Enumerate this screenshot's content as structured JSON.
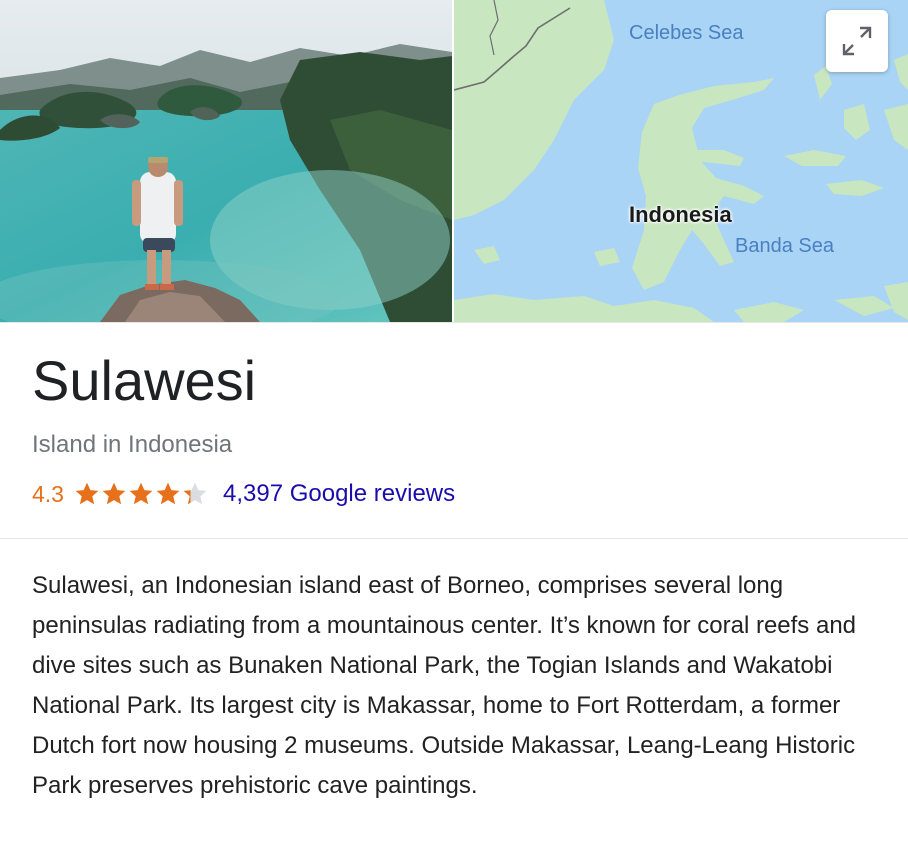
{
  "place": {
    "title": "Sulawesi",
    "subtitle": "Island in Indonesia",
    "rating": "4.3",
    "stars_filled": 4.3,
    "stars_total": 5,
    "reviews_link": "4,397 Google reviews",
    "description": "Sulawesi, an Indonesian island east of Borneo, comprises several long peninsulas radiating from a mountainous center. It’s known for coral reefs and dive sites such as Bunaken National Park, the Togian Islands and Wakatobi National Park. Its largest city is Makassar, home to Fort Rotterdam, a former Dutch fort now housing 2 museums. Outside Makassar, Leang-Leang Historic Park preserves prehistoric cave paintings."
  },
  "map": {
    "labels": {
      "celebes_sea": "Celebes Sea",
      "country": "Indonesia",
      "banda_sea": "Banda Sea"
    },
    "colors": {
      "water": "#a9d4f5",
      "land": "#c8e6c0",
      "border": "#6e6e6e"
    }
  },
  "icons": {
    "expand": "expand-icon",
    "star": "star-icon"
  },
  "colors": {
    "star": "#e7711b",
    "star_empty": "#dadce0",
    "link": "#1a0dab",
    "subtitle": "#70757a"
  }
}
